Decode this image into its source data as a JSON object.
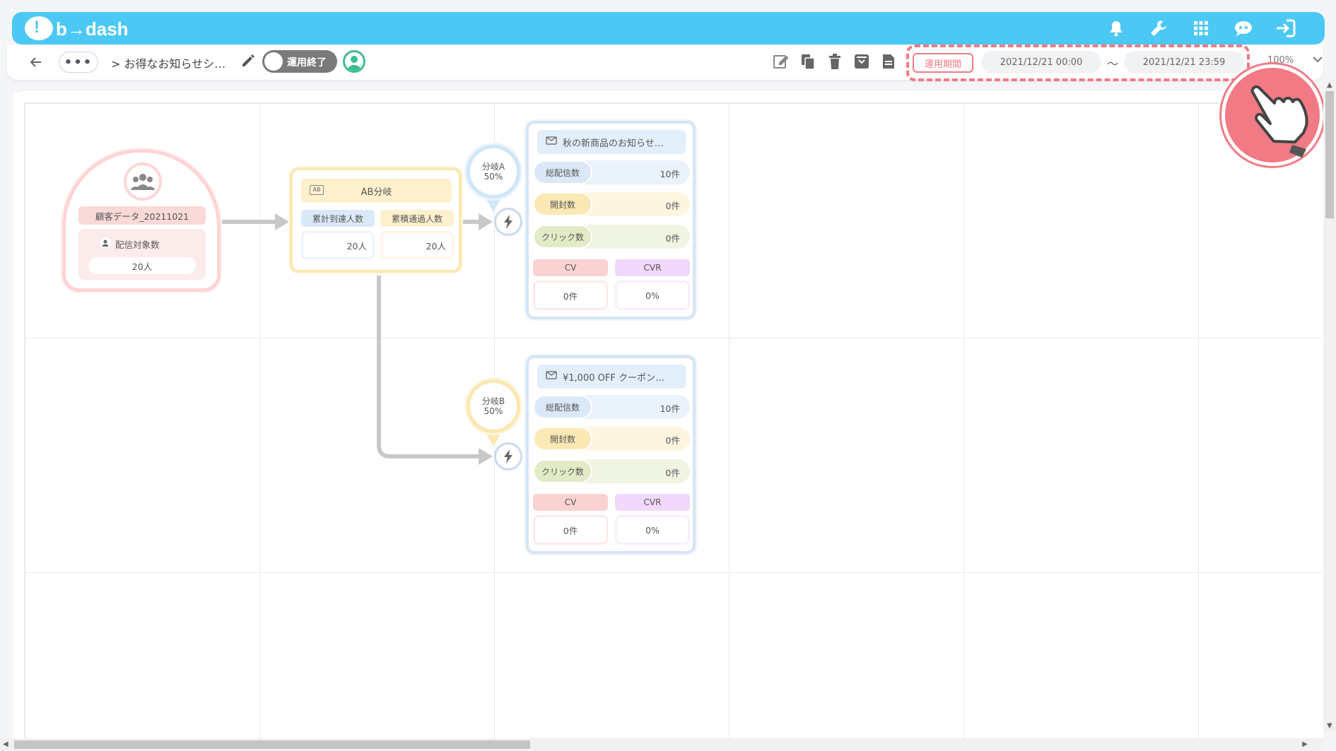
{
  "app": {
    "logo_text": "b→dash",
    "brand_color": "#4cc8f4"
  },
  "header_icons": [
    "bell-icon",
    "wrench-icon",
    "grid-apps-icon",
    "chat-bot-icon",
    "logout-icon"
  ],
  "toolbar": {
    "more_label": "•••",
    "breadcrumb": "> お得なお知らせシ…",
    "toggle_label": "運用終了",
    "period_label": "運用期間",
    "date_start": "2021/12/21 00:00",
    "tilde": "～",
    "date_end": "2021/12/21 23:59",
    "zoom": "100%"
  },
  "nodes": {
    "source": {
      "label": "顧客データ_20211021",
      "target_title": "配信対象数",
      "target_value": "20人"
    },
    "ab": {
      "title": "AB分岐",
      "col1_label": "累計到達人数",
      "col2_label": "累積通過人数",
      "col1_value": "20人",
      "col2_value": "20人"
    },
    "branch_a": {
      "name": "分岐A",
      "pct": "50%"
    },
    "branch_b": {
      "name": "分岐B",
      "pct": "50%"
    },
    "mail_a": {
      "title": "秋の新商品のお知らせ…",
      "sent_label": "総配信数",
      "sent_value": "10件",
      "open_label": "開封数",
      "open_value": "0件",
      "click_label": "クリック数",
      "click_value": "0件",
      "cv_label": "CV",
      "cvr_label": "CVR",
      "cv_value": "0件",
      "cvr_value": "0%"
    },
    "mail_b": {
      "title": "¥1,000 OFF クーポン…",
      "sent_label": "総配信数",
      "sent_value": "10件",
      "open_label": "開封数",
      "open_value": "0件",
      "click_label": "クリック数",
      "click_value": "0件",
      "cv_label": "CV",
      "cvr_label": "CVR",
      "cv_value": "0件",
      "cvr_value": "0%"
    }
  },
  "colors": {
    "highlight": "#f27a85",
    "toggle_off": "#7a7a7a",
    "avatar_ring": "#3cc08e"
  }
}
